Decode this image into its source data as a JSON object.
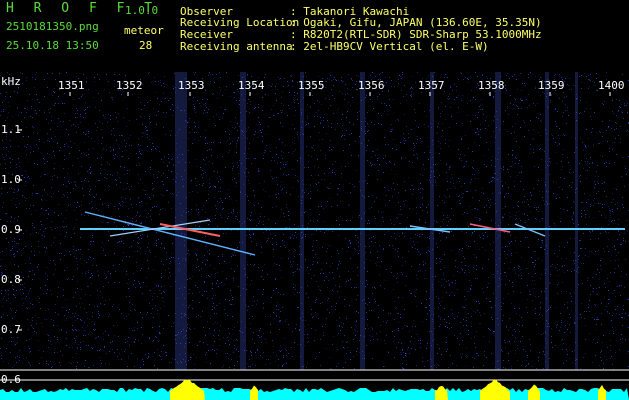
{
  "app": {
    "title": "H R O F F T",
    "version": "1.0.0"
  },
  "file": {
    "name": "2510181350.png",
    "datetime": "25.10.18 13:50"
  },
  "meteor": {
    "label": "meteor",
    "count": "28"
  },
  "info": {
    "observer_label": "Observer",
    "observer_value": ": Takanori Kawachi",
    "location_label": "Receiving Location",
    "location_value": ": Ogaki, Gifu, JAPAN (136.60E, 35.35N)",
    "receiver_label": "Receiver",
    "receiver_value": ": R820T2(RTL-SDR) SDR-Sharp 53.1000MHz",
    "antenna_label": "Receiving antenna",
    "antenna_value": ": 2el-HB9CV Vertical (el. E-W)"
  },
  "axis": {
    "y_unit": "kHz",
    "x_ticks": [
      "1351",
      "1352",
      "1353",
      "1354",
      "1355",
      "1356",
      "1357",
      "1358",
      "1359",
      "1400"
    ],
    "y_ticks": [
      "1.1",
      "1.0",
      "0.9",
      "0.8",
      "0.7",
      "0.6"
    ]
  },
  "colors": {
    "background": "#000000",
    "noise": "#1e2a8a",
    "trace": "#60d0ff",
    "power_fill": "#00ffff",
    "power_peak": "#ffff00",
    "header_green": "#5bdc3c",
    "header_yellow": "#ffff6a"
  }
}
